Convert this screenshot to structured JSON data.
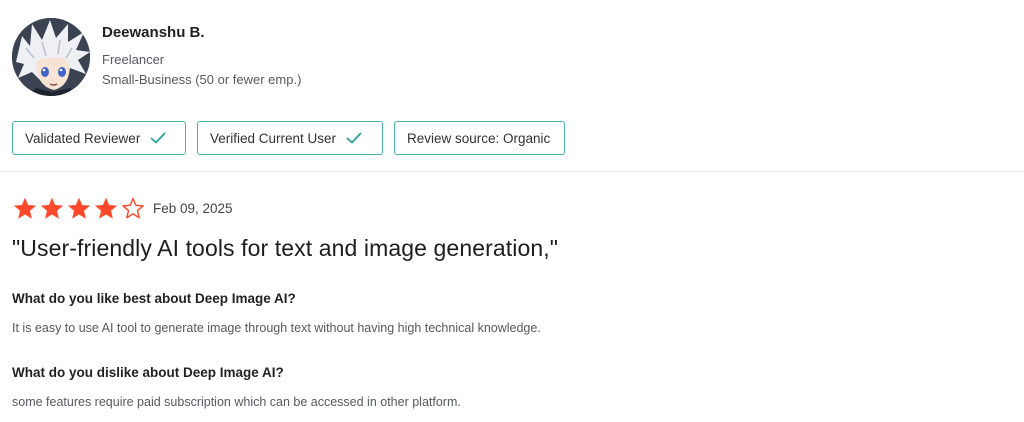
{
  "reviewer": {
    "name": "Deewanshu B.",
    "role": "Freelancer",
    "company_size": "Small-Business (50 or fewer emp.)"
  },
  "badges": [
    {
      "label": "Validated Reviewer",
      "checked": true
    },
    {
      "label": "Verified Current User",
      "checked": true
    },
    {
      "label": "Review source: Organic",
      "checked": false
    }
  ],
  "review": {
    "rating": 4,
    "max_rating": 5,
    "date": "Feb 09, 2025",
    "title": "\"User-friendly AI tools for text and image generation,\"",
    "questions": [
      {
        "question": "What do you like best about Deep Image AI?",
        "answer": "It is easy to use AI tool to generate image through text without having high technical knowledge."
      },
      {
        "question": "What do you dislike about Deep Image AI?",
        "answer": "some features require paid subscription which can be accessed in other platform."
      }
    ]
  },
  "colors": {
    "star_filled": "#ff492c",
    "star_empty_outline": "#ff492c",
    "badge_border": "#4bb3a8",
    "check": "#2aa198"
  },
  "icons": {
    "check": "check-icon",
    "star": "star-icon"
  }
}
